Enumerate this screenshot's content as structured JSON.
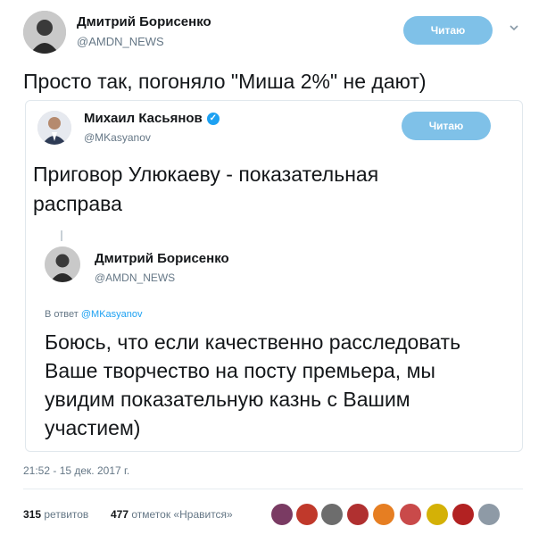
{
  "tweet": {
    "author_name": "Дмитрий Борисенко",
    "author_handle": "@AMDN_NEWS",
    "follow_label": "Читаю",
    "text": "Просто так, погоняло \"Миша 2%\" не дают)"
  },
  "quoted": {
    "author_name": "Михаил Касьянов",
    "author_handle": "@MKasyanov",
    "follow_label": "Читаю",
    "text_line1": "Приговор Улюкаеву - показательная",
    "text_line2": "расправа",
    "reply": {
      "author_name": "Дмитрий Борисенко",
      "author_handle": "@AMDN_NEWS",
      "reply_prefix": "В ответ",
      "reply_to": "@MKasyanov",
      "text_line1": "Боюсь, что если качественно расследовать",
      "text_line2": "Ваше творчество на посту премьера, мы",
      "text_line3": "увидим показательную казнь с Вашим",
      "text_line4": "участием)"
    }
  },
  "timestamp": "21:52 - 15 дек. 2017 г.",
  "stats": {
    "retweets_count": "315",
    "retweets_label": "ретвитов",
    "likes_count": "477",
    "likes_label": "отметок «Нравится»"
  },
  "colors": {
    "follow_button": "#7fc1e8",
    "verified_badge": "#1da1f2",
    "secondary_text": "#657786"
  },
  "icons": {
    "caret": "chevron-down-icon",
    "verified": "verified-badge-icon"
  }
}
